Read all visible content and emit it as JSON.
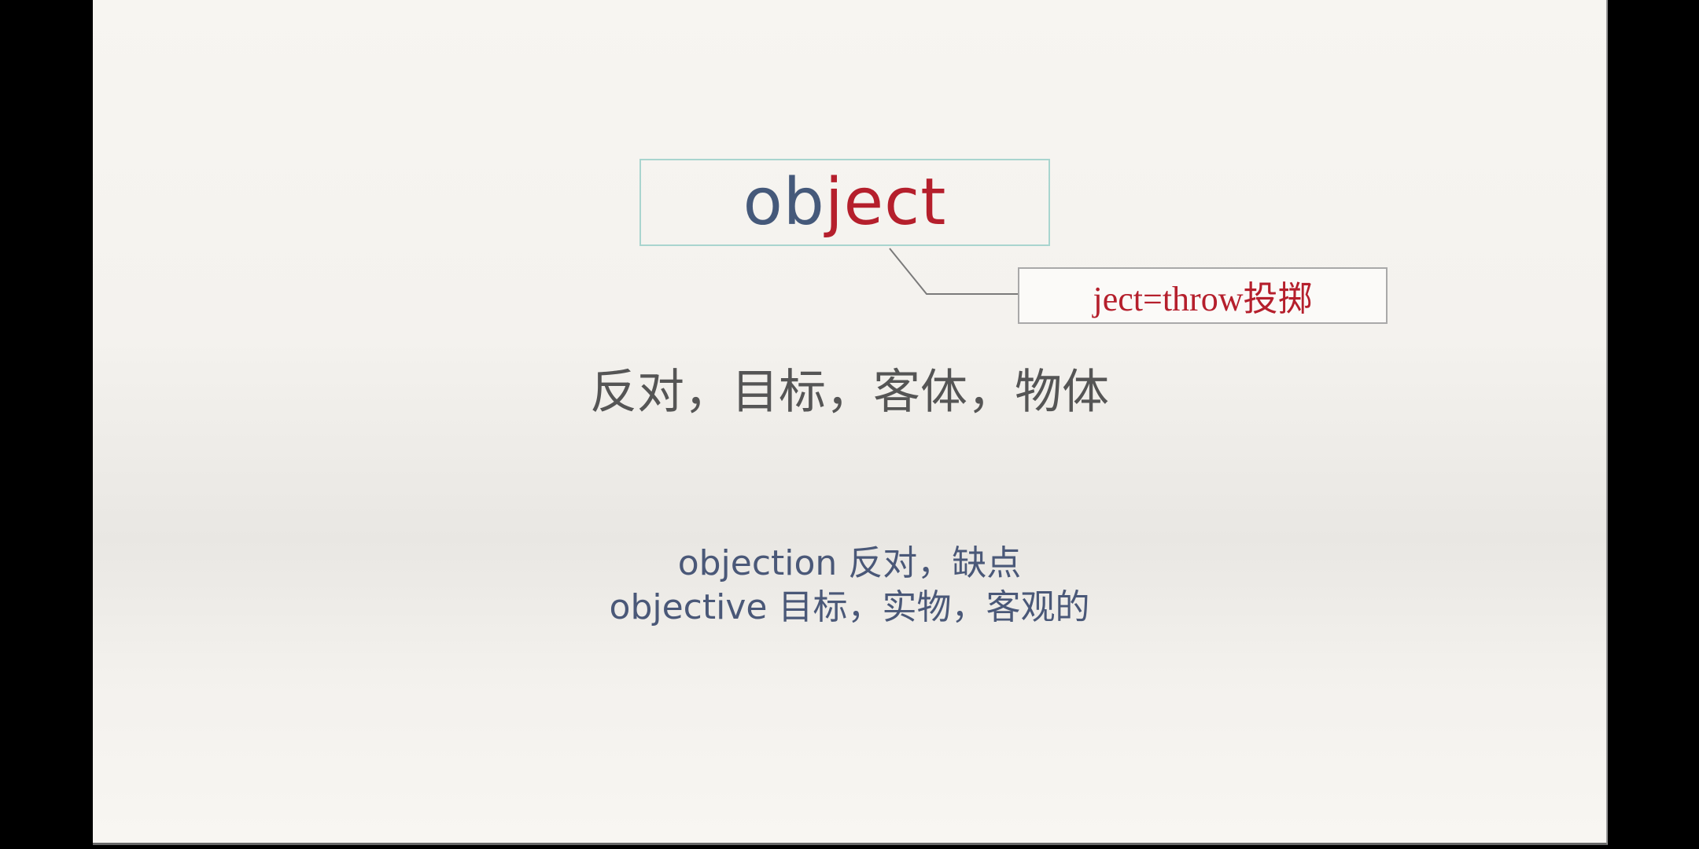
{
  "slide": {
    "word": {
      "root": "ob",
      "suffix": "ject"
    },
    "callout": "ject=throw投掷",
    "meaning": "反对，目标，客体，物体",
    "derived": [
      {
        "word": "objection",
        "meaning": "反对，缺点"
      },
      {
        "word": "objective",
        "meaning": "目标，实物，客观的"
      }
    ]
  },
  "colors": {
    "root": "#45597a",
    "suffix": "#b51f2c",
    "derived_text": "#4a5878",
    "meaning_text": "#555555",
    "word_box_border": "#a9d5cf"
  }
}
